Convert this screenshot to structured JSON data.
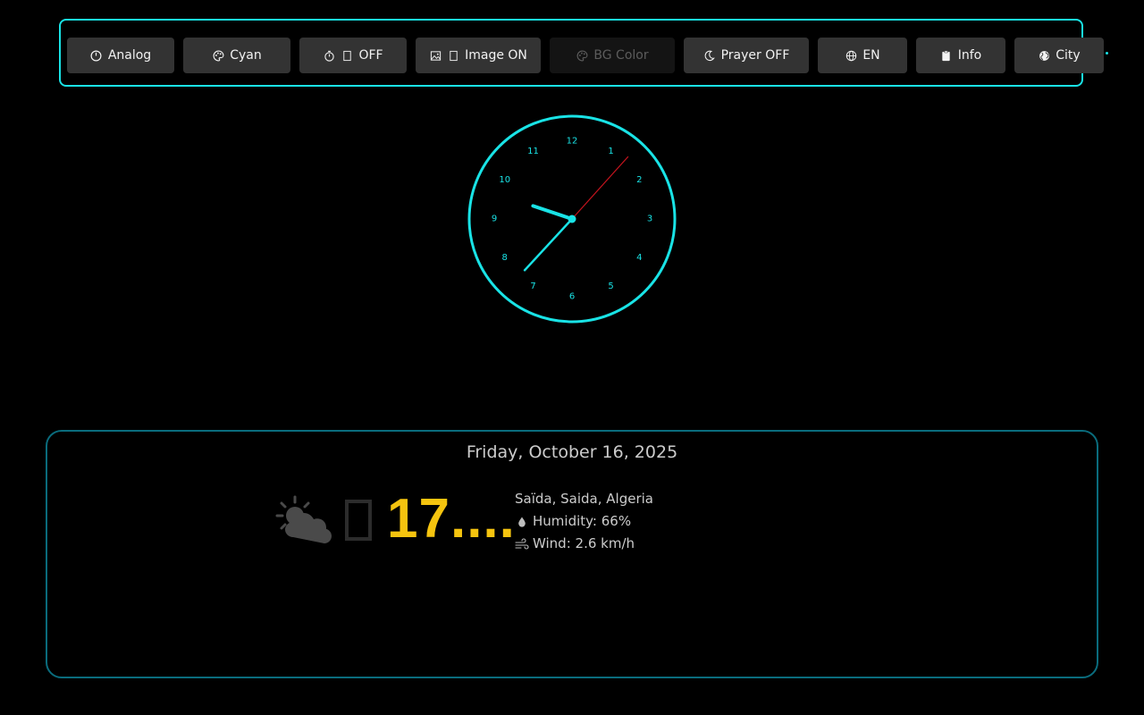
{
  "toolbar": {
    "buttons": [
      {
        "label": "Analog",
        "icon": "clock-icon"
      },
      {
        "label": "Cyan",
        "icon": "palette-icon"
      },
      {
        "label": "OFF",
        "icon": "timer-icon"
      },
      {
        "label": "Image ON",
        "icon": "image-icon"
      },
      {
        "label": "BG Color",
        "icon": "palette-icon",
        "disabled": true
      },
      {
        "label": "Prayer OFF",
        "icon": "moon-icon"
      },
      {
        "label": "EN",
        "icon": "globe-icon"
      },
      {
        "label": "Info",
        "icon": "clipboard-icon"
      },
      {
        "label": "City",
        "icon": "earth-icon"
      }
    ]
  },
  "clock": {
    "numbers": [
      "12",
      "1",
      "2",
      "3",
      "4",
      "5",
      "6",
      "7",
      "8",
      "9",
      "10",
      "11"
    ],
    "time": {
      "hour": 9,
      "minute": 37,
      "second": 7
    },
    "accent_color": "#19e3e6",
    "second_hand_color": "#c8141e"
  },
  "weather": {
    "date": "Friday, October 16, 2025",
    "icon": "partly-cloudy-icon",
    "temperature": "17....",
    "location": "Saïda, Saida, Algeria",
    "humidity": "Humidity: 66%",
    "wind": "Wind: 2.6 km/h",
    "temp_color": "#f5c40f",
    "panel_border_color": "#0a6c7d"
  }
}
